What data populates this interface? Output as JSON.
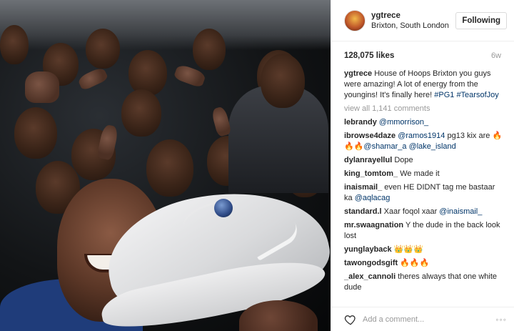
{
  "post": {
    "username": "ygtrece",
    "location": "Brixton, South London",
    "follow_label": "Following",
    "likes": "128,075 likes",
    "age": "6w"
  },
  "caption": {
    "user": "ygtrece",
    "text": "House of Hoops Brixton you guys were amazing! A lot of energy from the youngins! It's finally here!",
    "tags": [
      "#PG1",
      "#TearsofJoy"
    ]
  },
  "view_all": "view all 1,141 comments",
  "comments": [
    {
      "user": "lebrandy",
      "parts": [
        {
          "t": "link",
          "v": "@mmorrison_"
        }
      ]
    },
    {
      "user": "ibrowse4daze",
      "parts": [
        {
          "t": "link",
          "v": "@ramos1914"
        },
        {
          "t": "text",
          "v": " pg13 kix are "
        },
        {
          "t": "emoji",
          "v": "🔥🔥🔥"
        },
        {
          "t": "link",
          "v": "@shamar_a"
        },
        {
          "t": "text",
          "v": " "
        },
        {
          "t": "link",
          "v": "@lake_island"
        }
      ]
    },
    {
      "user": "dylanrayellul",
      "parts": [
        {
          "t": "text",
          "v": "Dope"
        }
      ]
    },
    {
      "user": "king_tomtom_",
      "parts": [
        {
          "t": "text",
          "v": "We made it"
        }
      ]
    },
    {
      "user": "inaismail_",
      "parts": [
        {
          "t": "text",
          "v": "even HE DIDNT tag me bastaar ka "
        },
        {
          "t": "link",
          "v": "@aqlacag"
        }
      ]
    },
    {
      "user": "standard.l",
      "parts": [
        {
          "t": "text",
          "v": "Xaar foqol xaar "
        },
        {
          "t": "link",
          "v": "@inaismail_"
        }
      ]
    },
    {
      "user": "mr.swaagnation",
      "parts": [
        {
          "t": "text",
          "v": "Y the dude in the back look lost"
        }
      ]
    },
    {
      "user": "yunglayback",
      "parts": [
        {
          "t": "emoji",
          "v": "👑👑👑"
        }
      ]
    },
    {
      "user": "tawongodsgift",
      "parts": [
        {
          "t": "emoji",
          "v": "🔥🔥🔥"
        }
      ]
    },
    {
      "user": "_alex_cannoli",
      "parts": [
        {
          "t": "text",
          "v": "theres always that one white dude"
        }
      ]
    }
  ],
  "footer": {
    "placeholder": "Add a comment...",
    "more": "◦◦◦"
  },
  "icons": {
    "avatar": "profile-avatar",
    "heart": "heart-icon",
    "more": "more-options-icon"
  },
  "colors": {
    "link": "#003569",
    "muted": "#999999",
    "border": "#efefef"
  }
}
